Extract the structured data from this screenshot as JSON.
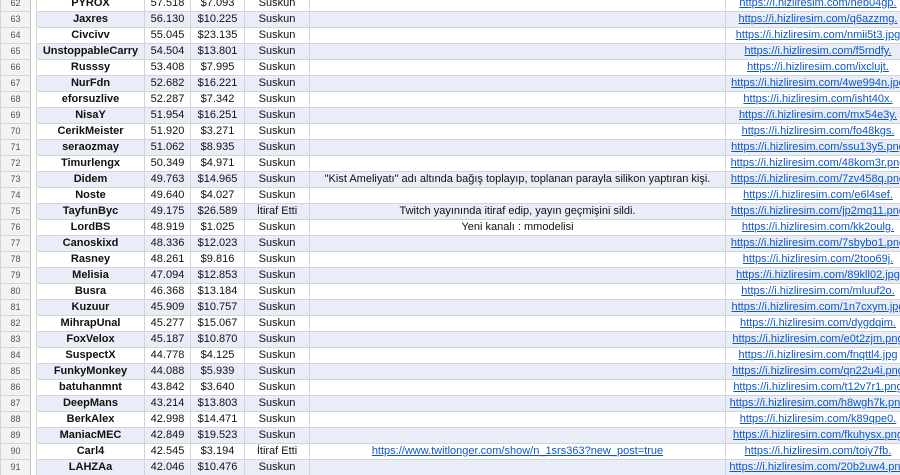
{
  "table": {
    "rows": [
      {
        "num": "62",
        "name": "PYROX",
        "score": "57.518",
        "amount": "$7.093",
        "status": "Suskun",
        "note": "",
        "link": "https://i.hizliresim.com/heb04gp."
      },
      {
        "num": "63",
        "name": "Jaxres",
        "score": "56.130",
        "amount": "$10.225",
        "status": "Suskun",
        "note": "",
        "link": "https://i.hizliresim.com/q6azzmg."
      },
      {
        "num": "64",
        "name": "Civcivv",
        "score": "55.045",
        "amount": "$23.135",
        "status": "Suskun",
        "note": "",
        "link": "https://i.hizliresim.com/nmii5t3.jpg"
      },
      {
        "num": "65",
        "name": "UnstoppableCarry",
        "score": "54.504",
        "amount": "$13.801",
        "status": "Suskun",
        "note": "",
        "link": "https://i.hizliresim.com/f5rndfy."
      },
      {
        "num": "66",
        "name": "Russsy",
        "score": "53.408",
        "amount": "$7.995",
        "status": "Suskun",
        "note": "",
        "link": "https://i.hizliresim.com/ixclujt."
      },
      {
        "num": "67",
        "name": "NurFdn",
        "score": "52.682",
        "amount": "$16.221",
        "status": "Suskun",
        "note": "",
        "link": "https://i.hizliresim.com/4we994n.jpg"
      },
      {
        "num": "68",
        "name": "eforsuzlive",
        "score": "52.287",
        "amount": "$7.342",
        "status": "Suskun",
        "note": "",
        "link": "https://i.hizliresim.com/isht40x."
      },
      {
        "num": "69",
        "name": "NisaY",
        "score": "51.954",
        "amount": "$16.251",
        "status": "Suskun",
        "note": "",
        "link": "https://i.hizliresim.com/mx54e3y."
      },
      {
        "num": "70",
        "name": "CerikMeister",
        "score": "51.920",
        "amount": "$3.271",
        "status": "Suskun",
        "note": "",
        "link": "https://i.hizliresim.com/fo48kgs."
      },
      {
        "num": "71",
        "name": "seraozmay",
        "score": "51.062",
        "amount": "$8.935",
        "status": "Suskun",
        "note": "",
        "link": "https://i.hizliresim.com/ssu13y5.png"
      },
      {
        "num": "72",
        "name": "Timurlengx",
        "score": "50.349",
        "amount": "$4.971",
        "status": "Suskun",
        "note": "",
        "link": "https://i.hizliresim.com/48kom3r.png"
      },
      {
        "num": "73",
        "name": "Didem",
        "score": "49.763",
        "amount": "$14.965",
        "status": "Suskun",
        "note": "\"Kist Ameliyatı\" adı altında bağış toplayıp, toplanan parayla silikon yaptıran kişi.",
        "link": "https://i.hizliresim.com/7zv458q.png"
      },
      {
        "num": "74",
        "name": "Noste",
        "score": "49.640",
        "amount": "$4.027",
        "status": "Suskun",
        "note": "",
        "link": "https://i.hizliresim.com/e6l4sef."
      },
      {
        "num": "75",
        "name": "TayfunByc",
        "score": "49.175",
        "amount": "$26.589",
        "status": "İtiraf Etti",
        "note": "Twitch yayınında itiraf edip, yayın geçmişini sildi.",
        "link": "https://i.hizliresim.com/jp2mq11.png"
      },
      {
        "num": "76",
        "name": "LordBS",
        "score": "48.919",
        "amount": "$1.025",
        "status": "Suskun",
        "note": "Yeni kanalı : mmodelisi",
        "link": "https://i.hizliresim.com/kk2oulg."
      },
      {
        "num": "77",
        "name": "Canoskixd",
        "score": "48.336",
        "amount": "$12.023",
        "status": "Suskun",
        "note": "",
        "link": "https://i.hizliresim.com/7sbybo1.png"
      },
      {
        "num": "78",
        "name": "Rasney",
        "score": "48.261",
        "amount": "$9.816",
        "status": "Suskun",
        "note": "",
        "link": "https://i.hizliresim.com/2too69j."
      },
      {
        "num": "79",
        "name": "Melisia",
        "score": "47.094",
        "amount": "$12.853",
        "status": "Suskun",
        "note": "",
        "link": "https://i.hizliresim.com/89kll02.jpg"
      },
      {
        "num": "80",
        "name": "Busra",
        "score": "46.368",
        "amount": "$13.184",
        "status": "Suskun",
        "note": "",
        "link": "https://i.hizliresim.com/mluuf2o."
      },
      {
        "num": "81",
        "name": "Kuzuur",
        "score": "45.909",
        "amount": "$10.757",
        "status": "Suskun",
        "note": "",
        "link": "https://i.hizliresim.com/1n7cxym.jpg"
      },
      {
        "num": "82",
        "name": "MihrapUnal",
        "score": "45.277",
        "amount": "$15.067",
        "status": "Suskun",
        "note": "",
        "link": "https://i.hizliresim.com/dygdqim."
      },
      {
        "num": "83",
        "name": "FoxVelox",
        "score": "45.187",
        "amount": "$10.870",
        "status": "Suskun",
        "note": "",
        "link": "https://i.hizliresim.com/e0t2zjm.png"
      },
      {
        "num": "84",
        "name": "SuspectX",
        "score": "44.778",
        "amount": "$4.125",
        "status": "Suskun",
        "note": "",
        "link": "https://i.hizliresim.com/fnqttl4.jpg"
      },
      {
        "num": "85",
        "name": "FunkyMonkey",
        "score": "44.088",
        "amount": "$5.939",
        "status": "Suskun",
        "note": "",
        "link": "https://i.hizliresim.com/qn22u4i.png"
      },
      {
        "num": "86",
        "name": "batuhanmnt",
        "score": "43.842",
        "amount": "$3.640",
        "status": "Suskun",
        "note": "",
        "link": "https://i.hizliresim.com/t12v7r1.png"
      },
      {
        "num": "87",
        "name": "DeepMans",
        "score": "43.214",
        "amount": "$13.803",
        "status": "Suskun",
        "note": "",
        "link": "https://i.hizliresim.com/h8wgh7k.png"
      },
      {
        "num": "88",
        "name": "BerkAlex",
        "score": "42.998",
        "amount": "$14.471",
        "status": "Suskun",
        "note": "",
        "link": "https://i.hizliresim.com/k89qpe0."
      },
      {
        "num": "89",
        "name": "ManiacMEC",
        "score": "42.849",
        "amount": "$19.523",
        "status": "Suskun",
        "note": "",
        "link": "https://i.hizliresim.com/fkuhysx.png"
      },
      {
        "num": "90",
        "name": "Carl4",
        "score": "42.545",
        "amount": "$3.194",
        "status": "İtiraf Etti",
        "note": "https://www.twitlonger.com/show/n_1srs363?new_post=true",
        "note_is_link": true,
        "link": "https://i.hizliresim.com/toiy7fb."
      },
      {
        "num": "91",
        "name": "LAHZAa",
        "score": "42.046",
        "amount": "$10.476",
        "status": "Suskun",
        "note": "",
        "link": "https://i.hizliresim.com/20b2uw4.png"
      }
    ]
  }
}
